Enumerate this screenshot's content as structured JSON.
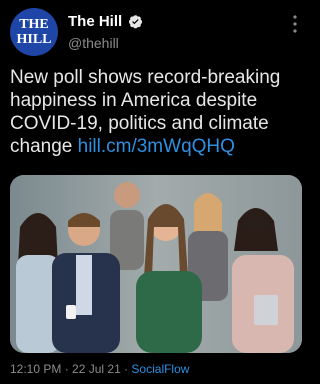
{
  "account": {
    "avatar_line1": "THE",
    "avatar_line2": "HILL",
    "display_name": "The Hill",
    "handle": "@thehill"
  },
  "tweet": {
    "text": "New poll shows record-breaking happiness in America despite COVID-19, politics and climate change",
    "link": "hill.cm/3mWqQHQ"
  },
  "meta": {
    "time": "12:10 PM",
    "separator1": " · ",
    "date": "22 Jul 21",
    "separator2": " · ",
    "source": "SocialFlow"
  },
  "icons": {
    "verified": "verified-badge-icon",
    "more": "more-vertical-icon"
  },
  "colors": {
    "background": "#000000",
    "link": "#2f8fe0",
    "avatar_bg": "#1f46a6"
  }
}
